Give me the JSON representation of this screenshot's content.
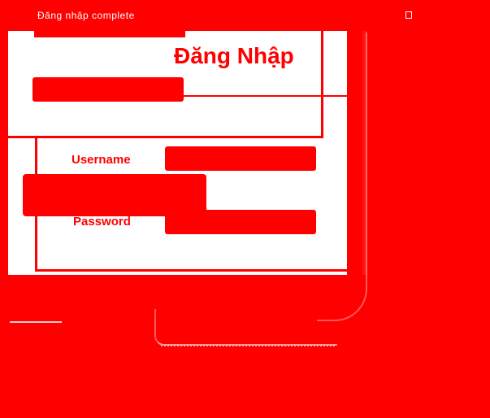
{
  "status_bar": {
    "text": "Đăng nhập complete",
    "window_icon": "window-restore-icon"
  },
  "login": {
    "title": "Đăng Nhập",
    "username_label": "Username",
    "password_label": "Password",
    "username_value": "",
    "password_value": ""
  },
  "colors": {
    "background": "#ff0000",
    "panel": "#ffffff",
    "text": "#ff0000"
  }
}
